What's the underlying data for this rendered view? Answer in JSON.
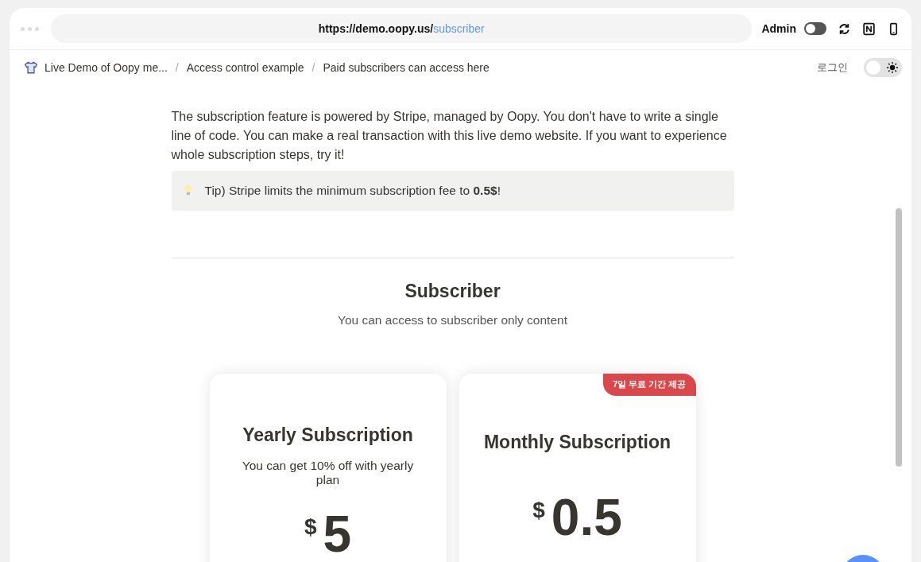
{
  "browser": {
    "url_host": "https://demo.oopy.us/",
    "url_path": "subscriber",
    "admin_label": "Admin",
    "admin_toggle": {
      "on": false
    }
  },
  "breadcrumbs": [
    "Live Demo of Oopy me...",
    "Access control example",
    "Paid subscribers can access here"
  ],
  "breadcrumb_separator": "/",
  "login": "로그인",
  "theme_toggle": {
    "on": false
  },
  "intro": "The subscription feature is powered by Stripe, managed by Oopy. You don't have to write a single line of code. You can make a real transaction with this live demo website. If you want to experience whole subscription steps, try it!",
  "callout": {
    "text": "Tip) Stripe limits the minimum subscription fee to **0.5$**!"
  },
  "section": {
    "title": "Subscriber",
    "subtitle": "You can access to subscriber only content"
  },
  "plans": [
    {
      "title": "Yearly Subscription",
      "description": "You can get 10% off with yearly plan",
      "currency": "$",
      "price": "5"
    },
    {
      "title": "Monthly Subscription",
      "badge": "7일 무료 기간 제공",
      "currency": "$",
      "price": "0.5"
    }
  ]
}
